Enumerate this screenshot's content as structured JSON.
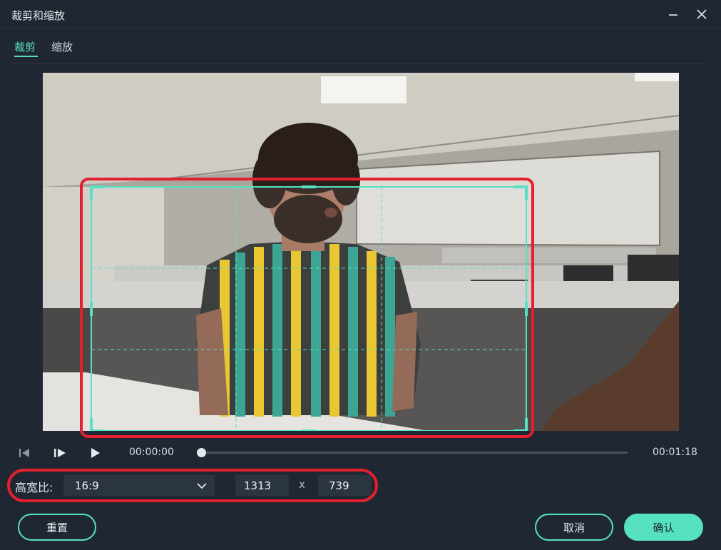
{
  "window": {
    "title": "裁剪和缩放"
  },
  "tabs": [
    {
      "label": "裁剪",
      "active": true
    },
    {
      "label": "缩放",
      "active": false
    }
  ],
  "playback": {
    "current_time": "00:00:00",
    "total_time": "00:01:18",
    "progress": 0
  },
  "crop": {
    "ratio_label": "高宽比:",
    "ratio_value": "16:9",
    "width": "1313",
    "separator": "x",
    "height": "739"
  },
  "buttons": {
    "reset": "重置",
    "cancel": "取消",
    "confirm": "确认"
  },
  "colors": {
    "accent": "#56e2c2",
    "highlight": "#e5202e",
    "background": "#1f2733"
  }
}
